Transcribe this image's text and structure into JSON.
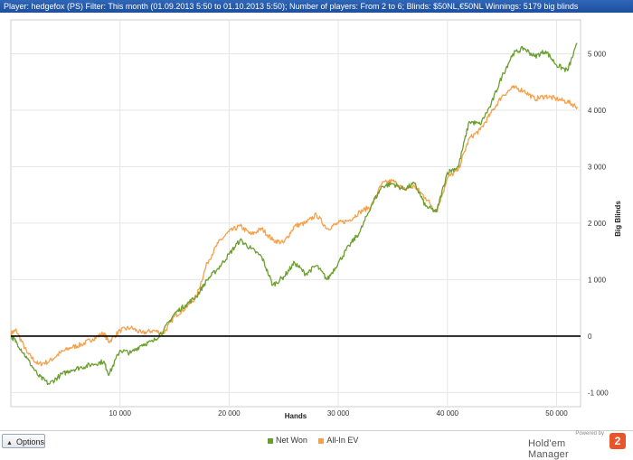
{
  "header": {
    "filter_text": "Player: hedgefox (PS)  Filter:  This month (01.09.2013 5:50 to 01.10.2013 5:50); Number of players: From 2 to 6; Blinds: $50NL,€50NL  Winnings:  5179 big blinds"
  },
  "footer": {
    "options_label": "Options",
    "brand_powered": "Powered by",
    "brand_name": "Hold'em Manager",
    "brand_logo": "2"
  },
  "colors": {
    "net_won": "#6a9e2e",
    "all_in_ev": "#f5a04a",
    "zero_line": "#000000",
    "grid": "#e6e6e6"
  },
  "chart_data": {
    "type": "line",
    "title": "",
    "xlabel": "Hands",
    "ylabel": "Big Blinds",
    "xlim": [
      0,
      52200
    ],
    "ylim": [
      -1250,
      5600
    ],
    "x_ticks": [
      10000,
      20000,
      30000,
      40000,
      50000
    ],
    "x_tick_labels": [
      "10 000",
      "20 000",
      "30 000",
      "40 000",
      "50 000"
    ],
    "y_ticks": [
      -1000,
      0,
      1000,
      2000,
      3000,
      4000,
      5000
    ],
    "y_tick_labels": [
      "-1 000",
      "0",
      "1 000",
      "2 000",
      "3 000",
      "4 000",
      "5 000"
    ],
    "grid": true,
    "legend_position": "bottom",
    "series": [
      {
        "name": "Net Won",
        "color": "#6a9e2e",
        "x": [
          0,
          500,
          1500,
          2500,
          3500,
          4500,
          5500,
          6500,
          7500,
          8500,
          9000,
          10000,
          11000,
          12000,
          13000,
          14000,
          15000,
          16000,
          17000,
          18000,
          19000,
          20000,
          21000,
          22000,
          23000,
          24000,
          25000,
          26000,
          27000,
          28000,
          29000,
          30000,
          31000,
          32000,
          33000,
          34000,
          35000,
          36000,
          37000,
          38000,
          39000,
          40000,
          41000,
          42000,
          43000,
          44000,
          45000,
          46000,
          47000,
          48000,
          49000,
          50000,
          51000,
          51900
        ],
        "y": [
          0,
          -100,
          -400,
          -700,
          -850,
          -700,
          -600,
          -550,
          -500,
          -450,
          -680,
          -250,
          -300,
          -150,
          -100,
          100,
          400,
          550,
          700,
          1000,
          1200,
          1450,
          1700,
          1550,
          1400,
          900,
          1050,
          1300,
          1100,
          1250,
          1000,
          1300,
          1600,
          1850,
          2300,
          2650,
          2700,
          2600,
          2700,
          2300,
          2200,
          2900,
          3000,
          3800,
          3750,
          4100,
          4600,
          5000,
          5100,
          4950,
          5050,
          4800,
          4700,
          5179
        ]
      },
      {
        "name": "All-In EV",
        "color": "#f5a04a",
        "x": [
          0,
          500,
          1500,
          2500,
          3500,
          4500,
          5500,
          6500,
          7500,
          8500,
          9000,
          10000,
          11000,
          12000,
          13000,
          14000,
          15000,
          16000,
          17000,
          18000,
          19000,
          20000,
          21000,
          22000,
          23000,
          24000,
          25000,
          26000,
          27000,
          28000,
          29000,
          30000,
          31000,
          32000,
          33000,
          34000,
          35000,
          36000,
          37000,
          38000,
          39000,
          40000,
          41000,
          42000,
          43000,
          44000,
          45000,
          46000,
          47000,
          48000,
          49000,
          50000,
          51000,
          51900
        ],
        "y": [
          50,
          100,
          -300,
          -500,
          -450,
          -300,
          -200,
          -150,
          -50,
          50,
          -100,
          100,
          150,
          50,
          100,
          50,
          350,
          500,
          700,
          1300,
          1650,
          1850,
          1950,
          1800,
          1900,
          1700,
          1650,
          1950,
          2000,
          2150,
          1900,
          2000,
          2050,
          2200,
          2300,
          2700,
          2750,
          2600,
          2650,
          2450,
          2200,
          2800,
          2950,
          3500,
          3650,
          3950,
          4250,
          4400,
          4350,
          4200,
          4250,
          4200,
          4150,
          4060
        ]
      }
    ]
  }
}
